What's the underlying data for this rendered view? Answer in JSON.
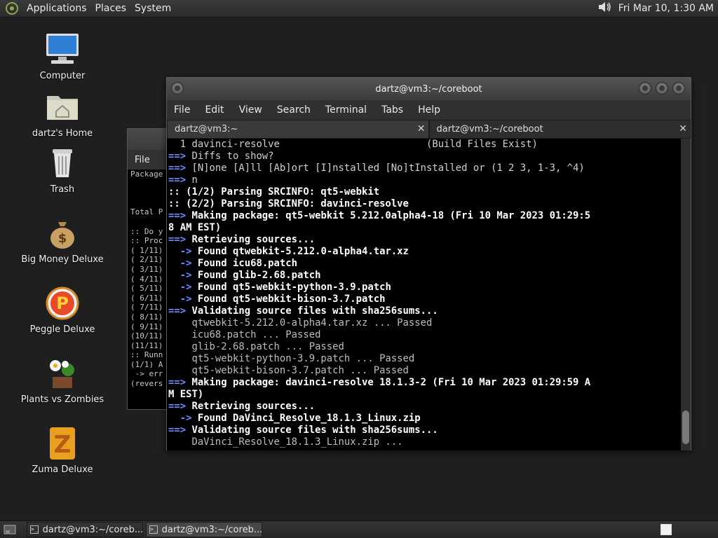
{
  "top_panel": {
    "menus": [
      "Applications",
      "Places",
      "System"
    ],
    "clock": "Fri Mar 10,  1:30 AM"
  },
  "desktop_icons": [
    {
      "label": "Computer",
      "icon": "computer-icon"
    },
    {
      "label": "dartz's Home",
      "icon": "home-folder-icon"
    },
    {
      "label": "Trash",
      "icon": "trash-icon"
    },
    {
      "label": "Big Money Deluxe",
      "icon": "money-bag-icon"
    },
    {
      "label": "Peggle Deluxe",
      "icon": "peggle-icon"
    },
    {
      "label": "Plants vs Zombies",
      "icon": "plants-icon"
    },
    {
      "label": "Zuma Deluxe",
      "icon": "zuma-icon"
    }
  ],
  "background_window": {
    "menu_label": "File",
    "lines": [
      "Package",
      "",
      "",
      "",
      "Total P",
      "",
      ":: Do y",
      ":: Proc",
      "( 1/11)",
      "( 2/11)",
      "( 3/11)",
      "( 4/11)",
      "( 5/11)",
      "( 6/11)",
      "( 7/11)",
      "( 8/11)",
      "( 9/11)",
      "(10/11)",
      "(11/11)",
      ":: Runn",
      "(1/1) A",
      " -> err",
      "(revers"
    ]
  },
  "main_window": {
    "title": "dartz@vm3:~/coreboot",
    "menus": [
      "File",
      "Edit",
      "View",
      "Search",
      "Terminal",
      "Tabs",
      "Help"
    ],
    "tabs": [
      {
        "label": "dartz@vm3:~",
        "close": "✕"
      },
      {
        "label": "dartz@vm3:~/coreboot",
        "close": "✕"
      }
    ],
    "terminal_lines": [
      {
        "text": "  1 davinci-resolve                         (Build Files Exist)",
        "style": "reg"
      },
      {
        "text": "==> Diffs to show?",
        "style": "reg"
      },
      {
        "text": "==> [N]one [A]ll [Ab]ort [I]nstalled [No]tInstalled or (1 2 3, 1-3, ^4)",
        "style": "reg"
      },
      {
        "text": "==> n",
        "style": "reg"
      },
      {
        "text": ":: (1/2) Parsing SRCINFO: qt5-webkit",
        "style": "bold"
      },
      {
        "text": ":: (2/2) Parsing SRCINFO: davinci-resolve",
        "style": "bold"
      },
      {
        "text": "==> Making package: qt5-webkit 5.212.0alpha4-18 (Fri 10 Mar 2023 01:29:5",
        "style": "bold"
      },
      {
        "text": "8 AM EST)",
        "style": "bold"
      },
      {
        "text": "==> Retrieving sources...",
        "style": "bold"
      },
      {
        "text": "  -> Found qtwebkit-5.212.0-alpha4.tar.xz",
        "style": "bold"
      },
      {
        "text": "  -> Found icu68.patch",
        "style": "bold"
      },
      {
        "text": "  -> Found glib-2.68.patch",
        "style": "bold"
      },
      {
        "text": "  -> Found qt5-webkit-python-3.9.patch",
        "style": "bold"
      },
      {
        "text": "  -> Found qt5-webkit-bison-3.7.patch",
        "style": "bold"
      },
      {
        "text": "==> Validating source files with sha256sums...",
        "style": "bold"
      },
      {
        "text": "    qtwebkit-5.212.0-alpha4.tar.xz ... Passed",
        "style": "dim"
      },
      {
        "text": "    icu68.patch ... Passed",
        "style": "dim"
      },
      {
        "text": "    glib-2.68.patch ... Passed",
        "style": "dim"
      },
      {
        "text": "    qt5-webkit-python-3.9.patch ... Passed",
        "style": "dim"
      },
      {
        "text": "    qt5-webkit-bison-3.7.patch ... Passed",
        "style": "dim"
      },
      {
        "text": "==> Making package: davinci-resolve 18.1.3-2 (Fri 10 Mar 2023 01:29:59 A",
        "style": "bold"
      },
      {
        "text": "M EST)",
        "style": "bold"
      },
      {
        "text": "==> Retrieving sources...",
        "style": "bold"
      },
      {
        "text": "  -> Found DaVinci_Resolve_18.1.3_Linux.zip",
        "style": "bold"
      },
      {
        "text": "==> Validating source files with sha256sums...",
        "style": "bold"
      },
      {
        "text": "    DaVinci_Resolve_18.1.3_Linux.zip ...",
        "style": "dim"
      }
    ]
  },
  "taskbar": {
    "items": [
      {
        "label": "dartz@vm3:~/coreb...",
        "active": false
      },
      {
        "label": "dartz@vm3:~/coreb...",
        "active": true
      }
    ]
  },
  "colors": {
    "arrow_blue": "#6b8cff",
    "desktop_bg": "#1f1f1f"
  }
}
